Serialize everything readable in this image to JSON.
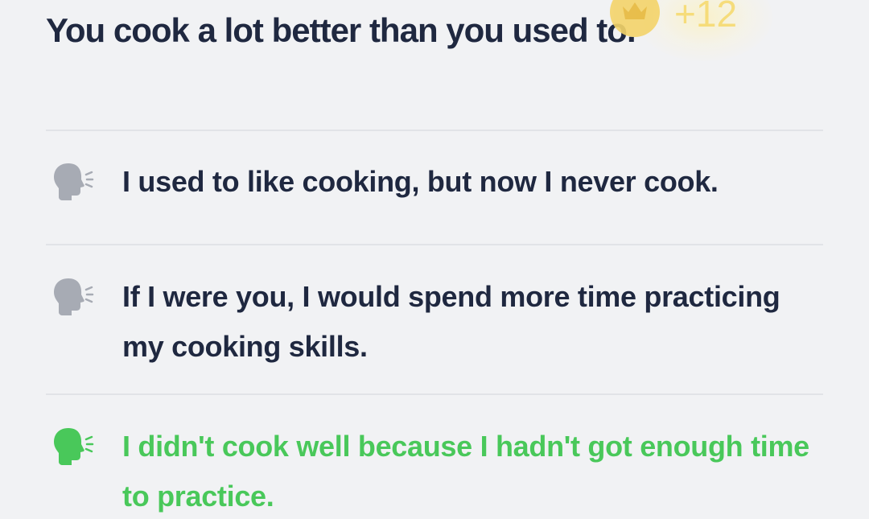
{
  "question": {
    "prompt": "You cook a lot better than you used to."
  },
  "reward": {
    "icon": "crown-coin-icon",
    "value": "+12",
    "color": "#f6d96a"
  },
  "options": [
    {
      "text": "I used to like cooking, but now I never cook.",
      "state": "neutral",
      "icon": "speaking-head-icon"
    },
    {
      "text": "If I were you, I would spend more time practicing my cooking skills.",
      "state": "neutral",
      "icon": "speaking-head-icon"
    },
    {
      "text": "I didn't cook well because I hadn't got enough time to practice.",
      "state": "correct",
      "icon": "speaking-head-icon"
    }
  ],
  "colors": {
    "background": "#f1f2f4",
    "text": "#1f2840",
    "neutral_icon": "#a7abb4",
    "correct": "#49c85a",
    "divider": "#e1e3e7"
  }
}
